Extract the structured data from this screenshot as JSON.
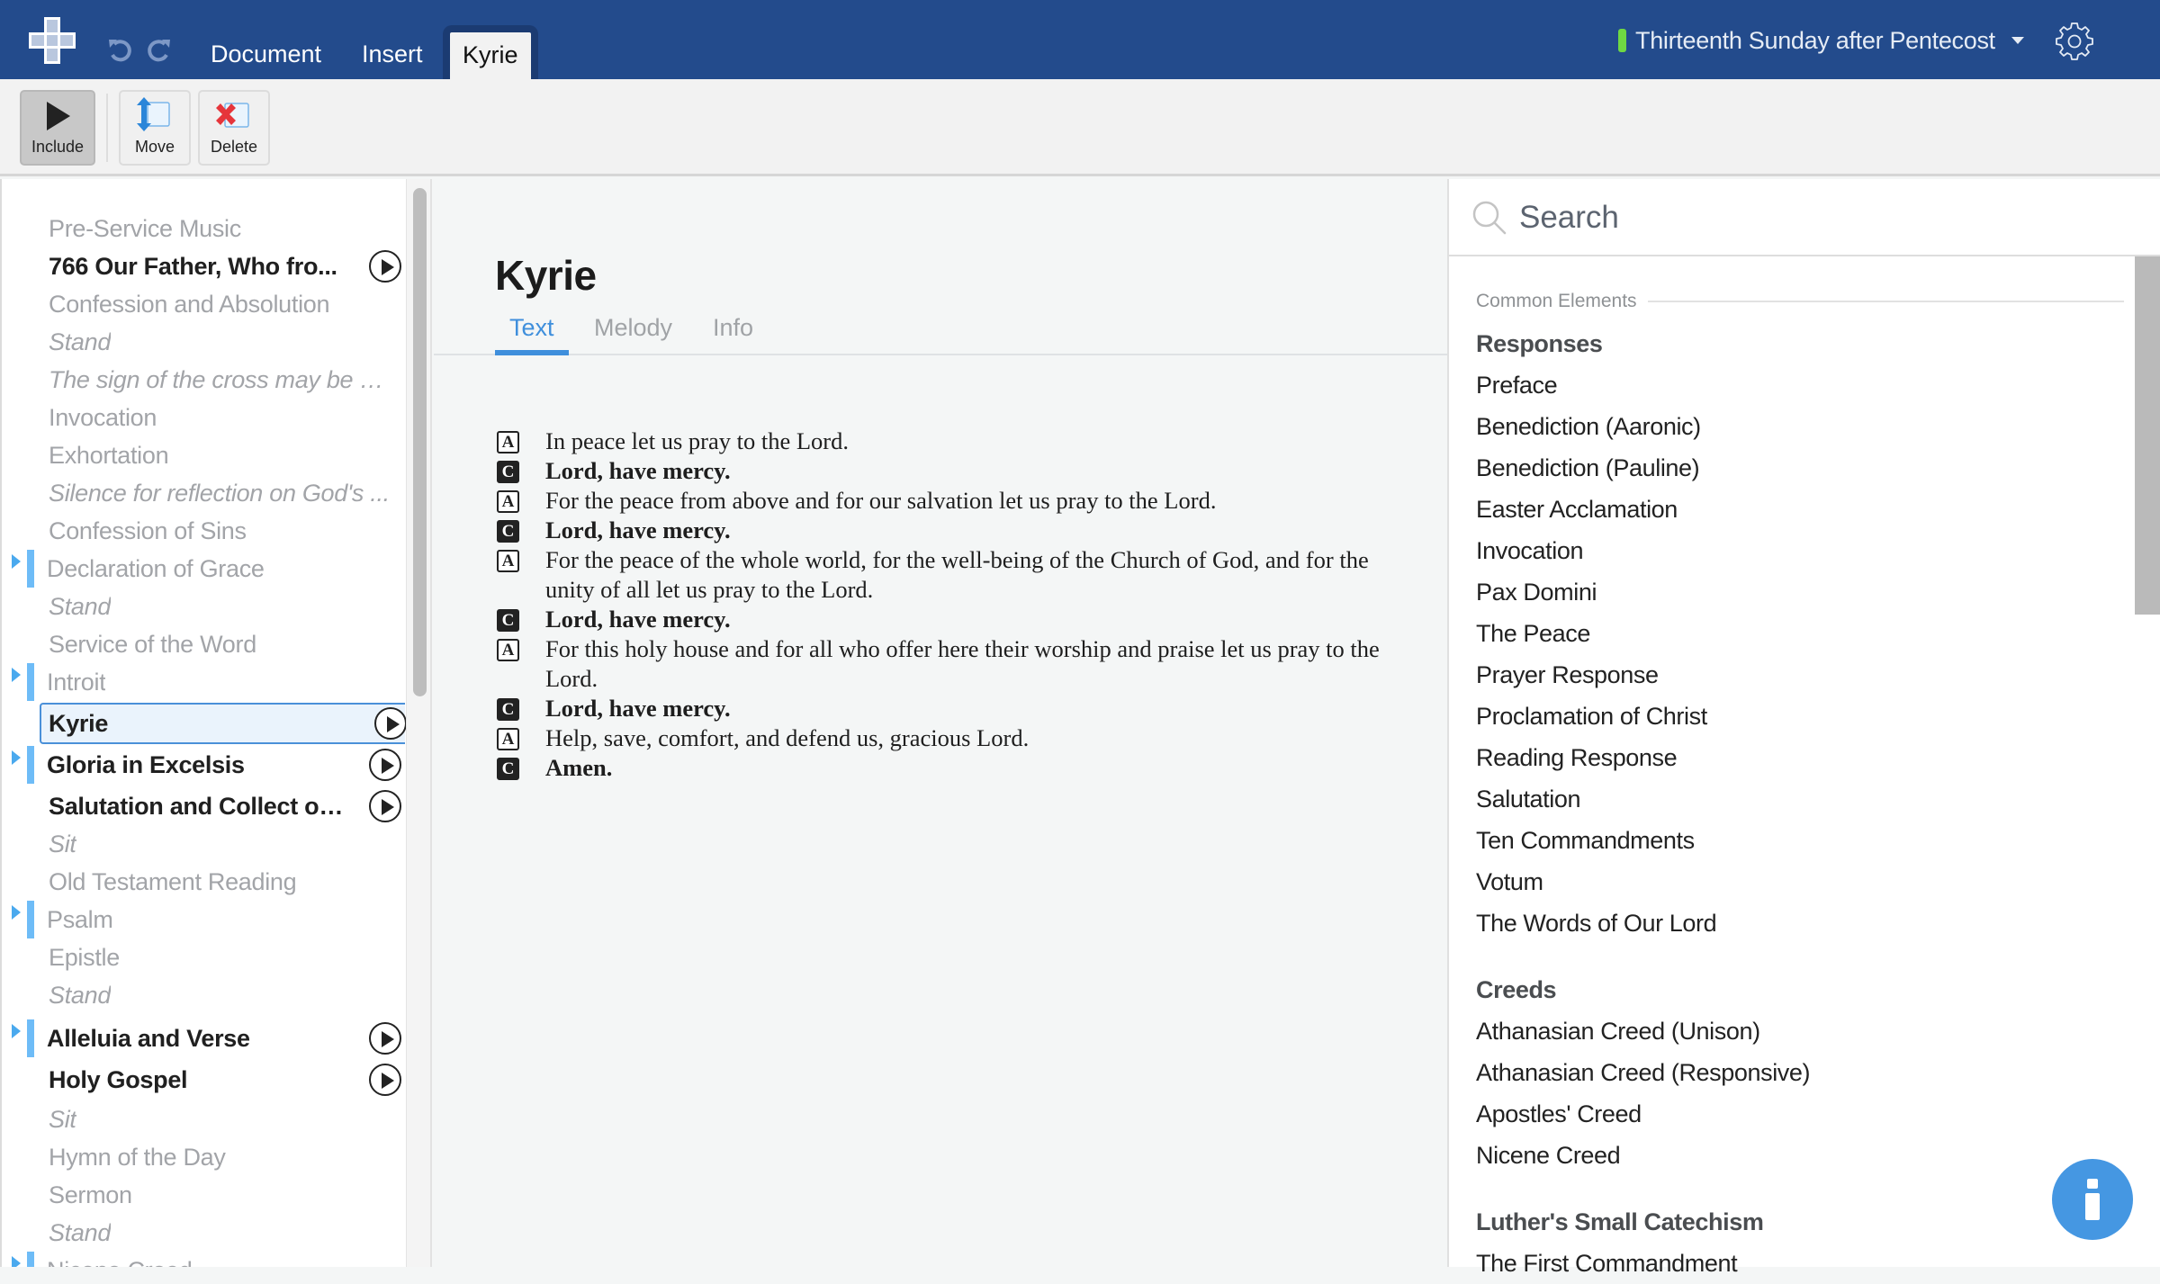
{
  "header": {
    "nav_tabs": [
      "Document",
      "Insert",
      "Kyrie"
    ],
    "active_tab": "Kyrie",
    "service": {
      "name": "Thirteenth Sunday after Pentecost",
      "status_color": "#6fd843"
    },
    "accent_color": "#234b8c"
  },
  "toolbar": {
    "include_label": "Include",
    "move_label": "Move",
    "delete_label": "Delete"
  },
  "sidebar": {
    "items": [
      {
        "label": "Pre-Service Music",
        "style": "normal"
      },
      {
        "label": "766 Our Father, Who fro...",
        "style": "bold",
        "play": true
      },
      {
        "label": "Confession and Absolution",
        "style": "normal"
      },
      {
        "label": "Stand",
        "style": "italic"
      },
      {
        "label": "The sign of the cross may be ma...",
        "style": "italic"
      },
      {
        "label": "Invocation",
        "style": "normal"
      },
      {
        "label": "Exhortation",
        "style": "normal"
      },
      {
        "label": "Silence for reflection on God's ...",
        "style": "italic"
      },
      {
        "label": "Confession of Sins",
        "style": "normal"
      },
      {
        "label": "Declaration of Grace",
        "style": "normal",
        "marker": true
      },
      {
        "label": "Stand",
        "style": "italic"
      },
      {
        "label": "Service of the Word",
        "style": "normal"
      },
      {
        "label": "Introit",
        "style": "normal",
        "marker": true
      },
      {
        "label": "Kyrie",
        "style": "bold",
        "play": true,
        "selected": true
      },
      {
        "label": "Gloria in Excelsis",
        "style": "bold",
        "play": true,
        "marker": true
      },
      {
        "label": "Salutation and Collect of t...",
        "style": "bold",
        "play": true
      },
      {
        "label": "Sit",
        "style": "italic"
      },
      {
        "label": "Old Testament Reading",
        "style": "normal"
      },
      {
        "label": "Psalm",
        "style": "normal",
        "marker": true
      },
      {
        "label": "Epistle",
        "style": "normal"
      },
      {
        "label": "Stand",
        "style": "italic"
      },
      {
        "label": "Alleluia and Verse",
        "style": "bold",
        "play": true,
        "marker": true
      },
      {
        "label": "Holy Gospel",
        "style": "bold",
        "play": true
      },
      {
        "label": "Sit",
        "style": "italic"
      },
      {
        "label": "Hymn of the Day",
        "style": "normal"
      },
      {
        "label": "Sermon",
        "style": "normal"
      },
      {
        "label": "Stand",
        "style": "italic"
      },
      {
        "label": "Nicene Creed",
        "style": "normal",
        "marker": true
      }
    ]
  },
  "main": {
    "title": "Kyrie",
    "tabs": [
      "Text",
      "Melody",
      "Info"
    ],
    "active_tab": "Text",
    "lines": [
      {
        "role": "A",
        "text": "In peace let us pray to the Lord."
      },
      {
        "role": "C",
        "text": "Lord, have mercy."
      },
      {
        "role": "A",
        "text": "For the peace from above and for our salvation let us pray to the Lord."
      },
      {
        "role": "C",
        "text": "Lord, have mercy."
      },
      {
        "role": "A",
        "text": "For the peace of the whole world, for the well-being of the Church of God, and for the unity of all let us pray to the Lord."
      },
      {
        "role": "C",
        "text": "Lord, have mercy."
      },
      {
        "role": "A",
        "text": "For this holy house and for all who offer here their worship and praise let us pray to the Lord."
      },
      {
        "role": "C",
        "text": "Lord, have mercy."
      },
      {
        "role": "A",
        "text": "Help, save, comfort, and defend us, gracious Lord."
      },
      {
        "role": "C",
        "text": "Amen."
      }
    ]
  },
  "library": {
    "search_placeholder": "Search",
    "section_label": "Common Elements",
    "groups": [
      {
        "title": "Responses",
        "items": [
          "Preface",
          "Benediction (Aaronic)",
          "Benediction (Pauline)",
          "Easter Acclamation",
          "Invocation",
          "Pax Domini",
          "The Peace",
          "Prayer Response",
          "Proclamation of Christ",
          "Reading Response",
          "Salutation",
          "Ten Commandments",
          "Votum",
          "The Words of Our Lord"
        ]
      },
      {
        "title": "Creeds",
        "items": [
          "Athanasian Creed (Unison)",
          "Athanasian Creed (Responsive)",
          "Apostles' Creed",
          "Nicene Creed"
        ]
      },
      {
        "title": "Luther's Small Catechism",
        "items": [
          "The First Commandment"
        ]
      }
    ]
  },
  "info_button": {
    "icon": "info-icon",
    "color": "#4597e2"
  }
}
